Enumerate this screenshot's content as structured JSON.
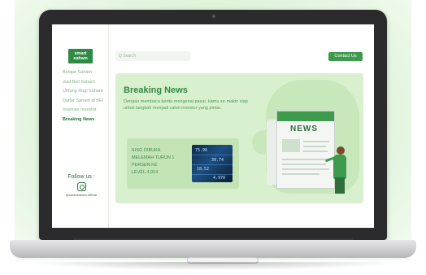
{
  "app": {
    "logo_line1": "smart",
    "logo_line2": "saham"
  },
  "sidebar": {
    "items": [
      {
        "label": "Belajar Saham",
        "active": false
      },
      {
        "label": "Jual Beli Saham",
        "active": false
      },
      {
        "label": "Untung Rugi Saham",
        "active": false
      },
      {
        "label": "Daftar Saham di BEI",
        "active": false
      },
      {
        "label": "Inspirasi Investor",
        "active": false
      },
      {
        "label": "Breaking News",
        "active": true
      }
    ],
    "follow_label": "Follow us :",
    "instagram_handle": "@smartsaham.official"
  },
  "header": {
    "search_placeholder": "Q  Search",
    "contact_label": "Contact Us"
  },
  "news": {
    "title": "Breaking News",
    "description": "Dengan membaca berita mengenai pasar, kamu se-makin siap untuk langkah menjadi calon investor yang pintar.",
    "headline_lines": [
      "IHSG DIBUKA",
      "MELEMAH TURUN 1",
      "PERSEN KE",
      "LEVEL 4.914"
    ],
    "newspaper_word": "NEWS",
    "stock_ticks": [
      "75.96",
      "30.74",
      "18.52",
      "4.970"
    ]
  },
  "colors": {
    "brand": "#2f8a44",
    "accent": "#3e9b4e",
    "card_bg": "#d9f0cf"
  }
}
